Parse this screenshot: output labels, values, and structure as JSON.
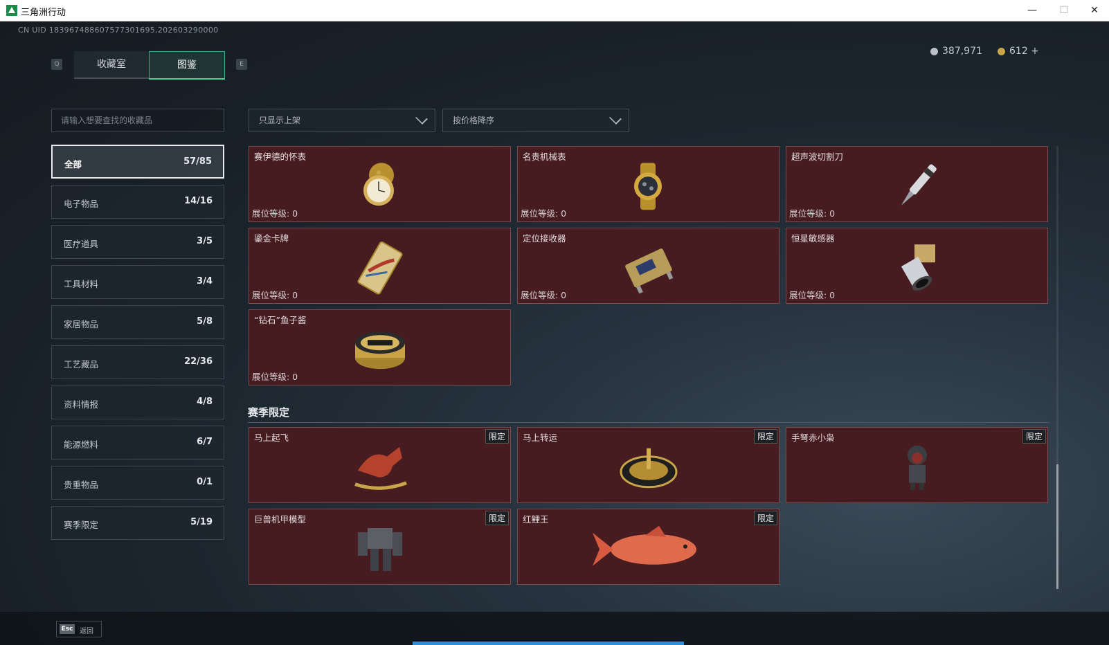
{
  "window": {
    "title": "三角洲行动",
    "minimize": "—",
    "maximize": "☐",
    "close": "✕"
  },
  "uid": "CN UID 1839674886075773016​95,202603290000",
  "hotkeys": {
    "prev_tab": "Q",
    "next_tab": "E"
  },
  "tabs": [
    {
      "label": "收藏室"
    },
    {
      "label": "图鉴",
      "active": true
    }
  ],
  "currency": {
    "silver": "387,971",
    "gold": "612 +",
    "silver_color": "#b9c0c6",
    "gold_color": "#c9a54a"
  },
  "search": {
    "placeholder": "请输入想要查找的收藏品"
  },
  "filters": {
    "shelf": "只显示上架",
    "sort": "按价格降序"
  },
  "categories": [
    {
      "label": "全部",
      "count": "57/85",
      "active": true
    },
    {
      "label": "电子物品",
      "count": "14/16"
    },
    {
      "label": "医疗道具",
      "count": "3/5"
    },
    {
      "label": "工具材料",
      "count": "3/4"
    },
    {
      "label": "家居物品",
      "count": "5/8"
    },
    {
      "label": "工艺藏品",
      "count": "22/36"
    },
    {
      "label": "资料情报",
      "count": "4/8"
    },
    {
      "label": "能源燃料",
      "count": "6/7"
    },
    {
      "label": "贵重物品",
      "count": "0/1"
    },
    {
      "label": "赛季限定",
      "count": "5/19"
    }
  ],
  "items": [
    {
      "name": "赛伊德的怀表",
      "level": "展位等级: 0",
      "icon": "pocket-watch-icon"
    },
    {
      "name": "名贵机械表",
      "level": "展位等级: 0",
      "icon": "wristwatch-icon"
    },
    {
      "name": "超声波切割刀",
      "level": "展位等级: 0",
      "icon": "ultrasonic-cutter-icon"
    },
    {
      "name": "鎏金卡牌",
      "level": "展位等级: 0",
      "icon": "gilded-card-icon"
    },
    {
      "name": "定位接收器",
      "level": "展位等级: 0",
      "icon": "locator-receiver-icon"
    },
    {
      "name": "恒星敏感器",
      "level": "展位等级: 0",
      "icon": "star-sensor-icon"
    },
    {
      "name": "“钻石”鱼子酱",
      "level": "展位等级: 0",
      "icon": "caviar-tin-icon"
    }
  ],
  "season_section": {
    "title": "赛季限定",
    "tag": "限定",
    "items": [
      {
        "name": "马上起飞",
        "icon": "rocking-horse-icon"
      },
      {
        "name": "马上转运",
        "icon": "fortune-wheel-icon"
      },
      {
        "name": "手弩赤小枭",
        "icon": "hooded-figure-icon"
      },
      {
        "name": "巨兽机甲模型",
        "icon": "mech-model-icon"
      },
      {
        "name": "红鲤王",
        "icon": "red-carp-icon"
      }
    ]
  },
  "footer": {
    "esc_key": "Esc",
    "back_label": "返回"
  }
}
